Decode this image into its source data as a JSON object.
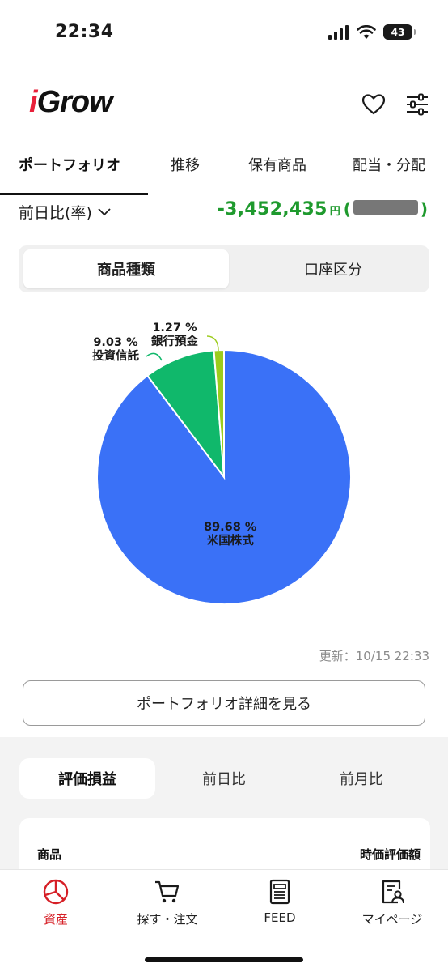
{
  "status_bar": {
    "time": "22:34",
    "battery": "43"
  },
  "header": {
    "logo": "iGrow",
    "icons": [
      "heart-icon",
      "filter-sliders-icon"
    ]
  },
  "top_tabs": [
    {
      "label": "ポートフォリオ",
      "active": true
    },
    {
      "label": "推移",
      "active": false
    },
    {
      "label": "保有商品",
      "active": false
    },
    {
      "label": "配当・分配",
      "active": false
    }
  ],
  "change": {
    "label": "前日比(率)",
    "amount": "-3,452,435",
    "unit": "円",
    "open_paren": "(",
    "close_paren": ")",
    "color": "#1f9a2e"
  },
  "segmented": {
    "active": "商品種類",
    "inactive": "口座区分"
  },
  "chart_data": {
    "type": "pie",
    "slices": [
      {
        "label": "米国株式",
        "value": 89.68,
        "display": "89.68 %",
        "color": "#3a71f7"
      },
      {
        "label": "投資信託",
        "value": 9.03,
        "display": "9.03 %",
        "color": "#10b86b"
      },
      {
        "label": "銀行預金",
        "value": 1.27,
        "display": "1.27 %",
        "color": "#9ccc1c"
      }
    ]
  },
  "updated": "更新：10/15 22:33",
  "detail_button": "ポートフォリオ詳細を見る",
  "sub_tabs": [
    {
      "label": "評価損益",
      "active": true
    },
    {
      "label": "前日比",
      "active": false
    },
    {
      "label": "前月比",
      "active": false
    }
  ],
  "table": {
    "col_product": "商品",
    "col_value": "時価評価額"
  },
  "bottom_nav": [
    {
      "label": "資産",
      "icon": "pie-chart-icon",
      "active": true
    },
    {
      "label": "探す・注文",
      "icon": "cart-icon",
      "active": false
    },
    {
      "label": "FEED",
      "icon": "newspaper-icon",
      "active": false
    },
    {
      "label": "マイページ",
      "icon": "profile-icon",
      "active": false
    }
  ]
}
